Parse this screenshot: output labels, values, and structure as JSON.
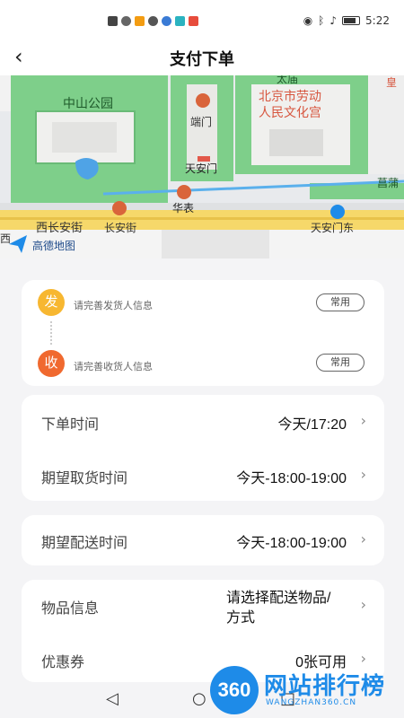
{
  "status_bar": {
    "time": "5:22",
    "left_icons": [
      "notification-icon",
      "wifi-icon",
      "app-icon-orange",
      "app-icon-gray",
      "app-icon-blue",
      "app-icon-teal",
      "app-icon-red"
    ],
    "right_icons": [
      "eye-icon",
      "bluetooth-icon",
      "mute-icon",
      "battery-icon"
    ]
  },
  "navbar": {
    "back_icon": "chevron-left-icon",
    "title": "支付下单"
  },
  "map": {
    "labels": {
      "park": "中山公园",
      "duanmen": "端门",
      "tiananmen": "天安门",
      "huabiao": "华表",
      "xichangan": "西长安街",
      "changanjie": "长安街",
      "tiananmen_east": "天安门东",
      "workers_palace": "北京市劳动\n人民文化宫",
      "workers_palace_l1": "北京市劳动",
      "workers_palace_l2": "人民文化宫",
      "taimiao": "太庙",
      "puhe": "菖蒲",
      "xi": "西",
      "huang": "皇",
      "amap": "高德地图"
    },
    "colors": {
      "green": "#7ecf8a",
      "road": "#f5d65c",
      "building": "#f3f3f3",
      "water": "#4fa3e6"
    }
  },
  "address": {
    "sender_badge": "发",
    "sender_hint": "请完善发货人信息",
    "sender_chip": "常用",
    "receiver_badge": "收",
    "receiver_hint": "请完善收货人信息",
    "receiver_chip": "常用"
  },
  "order": {
    "order_time_label": "下单时间",
    "order_time_value": "今天/17:20",
    "pickup_label": "期望取货时间",
    "pickup_value": "今天-18:00-19:00",
    "delivery_label": "期望配送时间",
    "delivery_value": "今天-18:00-19:00",
    "goods_label": "物品信息",
    "goods_value": "请选择配送物品/方式",
    "coupon_label": "优惠券",
    "coupon_value": "0张可用"
  },
  "bottom_nav": {
    "back": "◁",
    "home": "○",
    "recent": "□"
  },
  "watermark": {
    "circle": "360",
    "text": "网站排行榜",
    "sub": "WANGZHAN360.CN"
  }
}
